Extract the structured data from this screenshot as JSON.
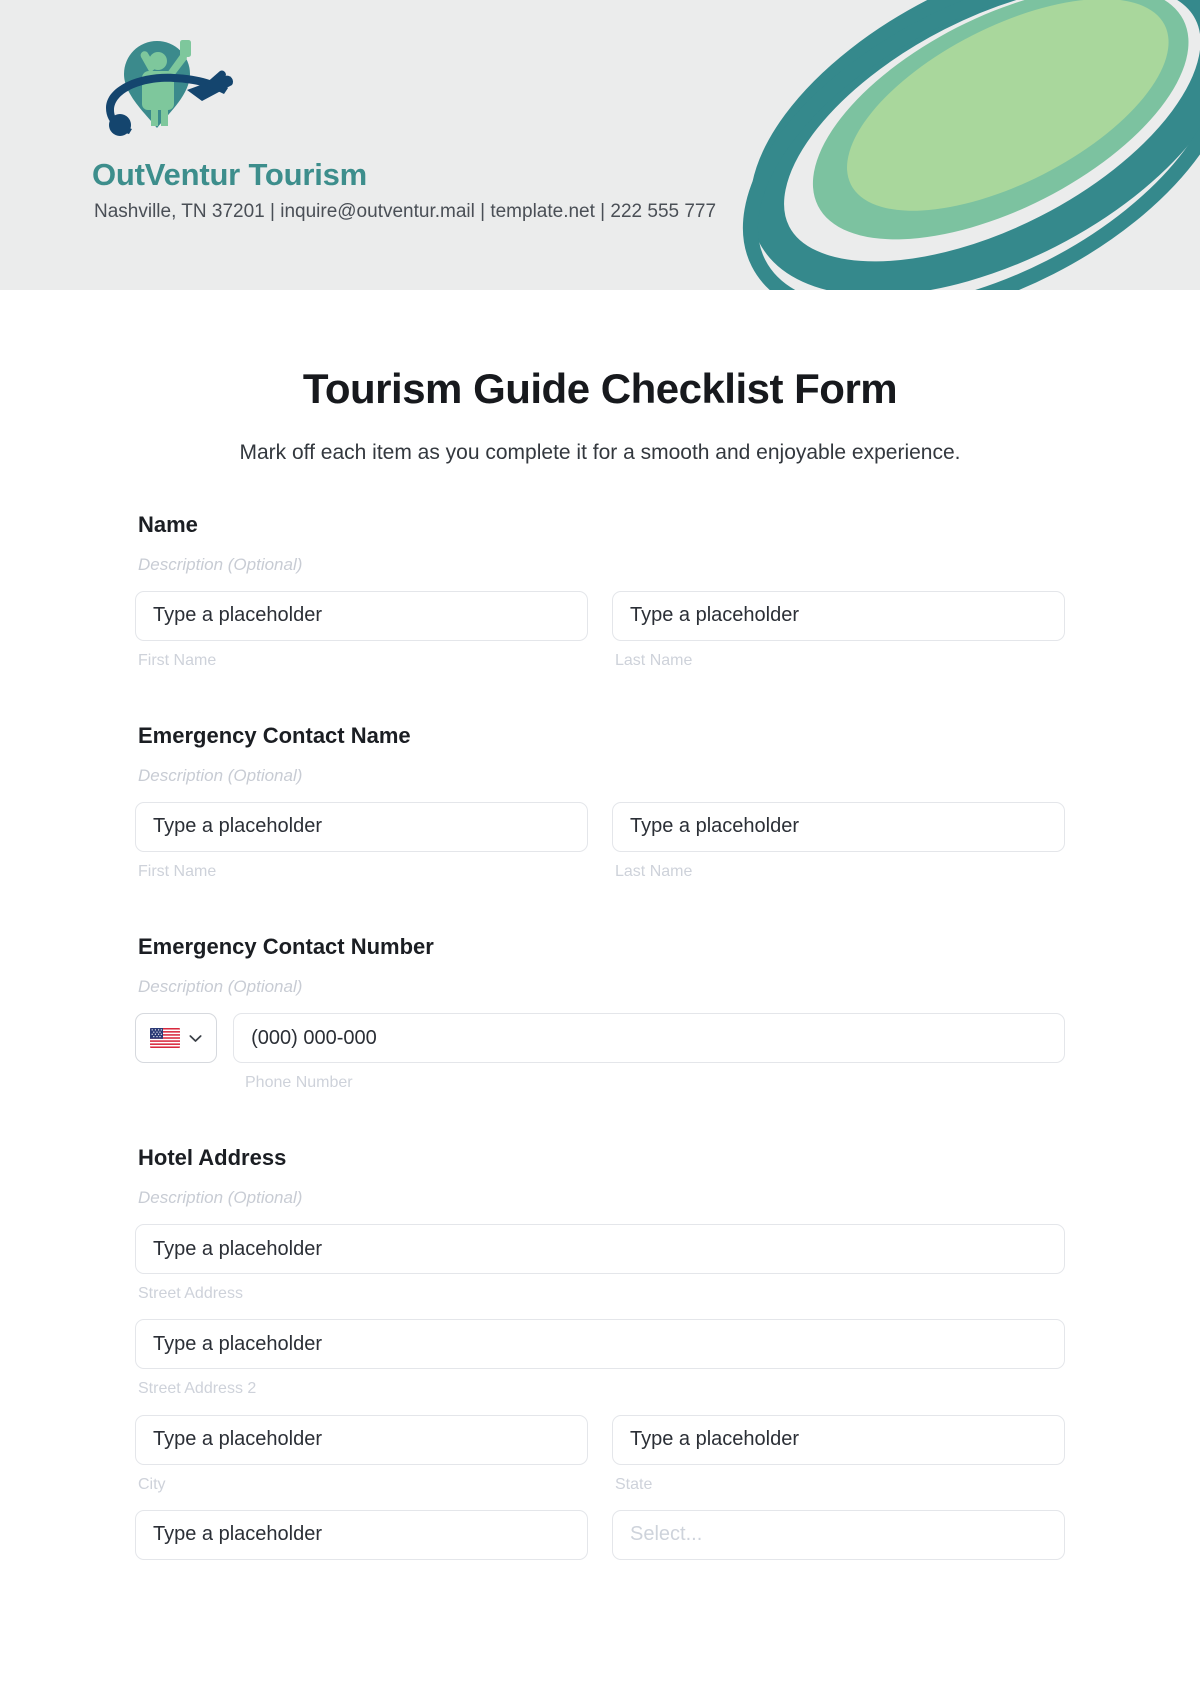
{
  "header": {
    "brand_name": "OutVentur Tourism",
    "contact_line": "Nashville, TN 37201 | inquire@outventur.mail | template.net | 222 555 777",
    "logo_icon": "tourist-selfie-globe-airplane-logo",
    "swoosh_icon": "ellipse-swoosh-graphic",
    "bg_color": "#EBECEC",
    "brand_color": "#3D8E8C"
  },
  "form": {
    "title": "Tourism Guide Checklist Form",
    "subtitle": "Mark off each item as you complete it for a smooth and enjoyable experience.",
    "description_placeholder": "Description (Optional)",
    "text_placeholder": "Type a placeholder",
    "select_placeholder": "Select...",
    "phone_placeholder": "(000) 000-000",
    "sections": [
      {
        "label": "Name",
        "description": "Description (Optional)",
        "sub_labels": {
          "first": "First Name",
          "last": "Last Name"
        }
      },
      {
        "label": "Emergency Contact Name",
        "description": "Description (Optional)",
        "sub_labels": {
          "first": "First Name",
          "last": "Last Name"
        }
      },
      {
        "label": "Emergency Contact Number",
        "description": "Description (Optional)",
        "sub_labels": {
          "phone": "Phone Number"
        },
        "country_flag": "us-flag-icon",
        "chevron": "chevron-down-icon"
      },
      {
        "label": "Hotel Address",
        "description": "Description (Optional)",
        "sub_labels": {
          "street1": "Street Address",
          "street2": "Street Address 2",
          "city": "City",
          "state": "State"
        }
      }
    ]
  }
}
